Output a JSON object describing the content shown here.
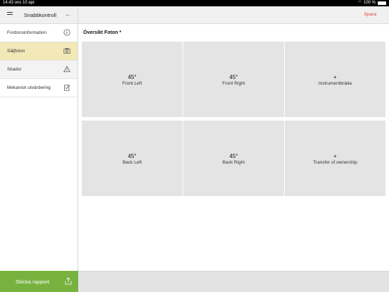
{
  "status": {
    "time_date": "14:43  ons 10 apr.",
    "battery": "100 %"
  },
  "sidebar": {
    "title": "Snabbkontroll",
    "items": [
      {
        "label": "Fordonsinformation",
        "icon": "info-icon"
      },
      {
        "label": "Säljfoton",
        "icon": "camera-icon"
      },
      {
        "label": "Skador",
        "icon": "warning-icon"
      },
      {
        "label": "Mekanisk utvärdering",
        "icon": "checklist-icon"
      }
    ],
    "send_label": "Skicka rapport"
  },
  "topbar": {
    "save_label": "Spara"
  },
  "main": {
    "section_title": "Översikt Foton *",
    "tiles": [
      {
        "big": "45°",
        "small": "Front Left"
      },
      {
        "big": "45°",
        "small": "Front Right"
      },
      {
        "big": "+",
        "small": "Instrumentbräda"
      },
      {
        "big": "45°",
        "small": "Back Left"
      },
      {
        "big": "45°",
        "small": "Back Right"
      },
      {
        "big": "+",
        "small": "Transfer of ownership"
      }
    ]
  },
  "colors": {
    "accent_active": "#f2e8b8",
    "send_green": "#77b23e",
    "save_red": "#e03c3c"
  }
}
